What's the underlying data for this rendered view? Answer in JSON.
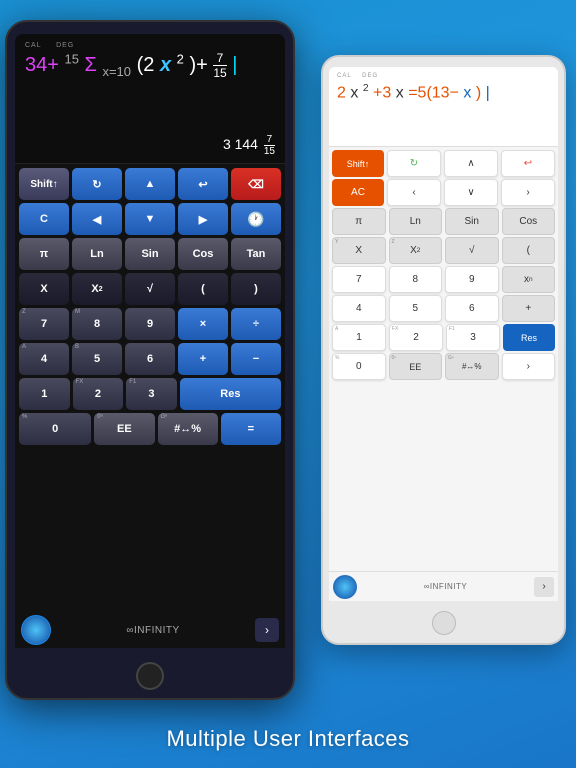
{
  "page": {
    "background": "#2196e0",
    "bottom_text": "Multiple User Interfaces"
  },
  "dark_tablet": {
    "mode": "CAL    DEG",
    "expression": "34+ Σ(2x²)+ 7/15",
    "result": "3 144 7/15",
    "rows": [
      [
        "Shift↑",
        "→",
        "▲",
        "↩",
        "⌫"
      ],
      [
        "C",
        "◀",
        "▼",
        "▶",
        "🕐"
      ],
      [
        "π",
        "Ln",
        "Sin",
        "Cos",
        "Tan"
      ],
      [
        "X",
        "X²",
        "√",
        "(",
        ")"
      ],
      [
        "7",
        "8",
        "9",
        "×",
        "÷"
      ],
      [
        "4",
        "5",
        "6",
        "+",
        "−"
      ],
      [
        "1",
        "2",
        "3",
        "Res",
        "="
      ],
      [
        "0",
        "EE",
        "#↔%",
        "=",
        ""
      ]
    ],
    "bottom": {
      "infinity_text": "∞INFINITY",
      "arrow": "›"
    }
  },
  "white_tablet": {
    "mode": "CAL    DEG",
    "expression": "2x²+3x=5(13−x)",
    "rows": [
      [
        "Shift↑",
        "↺",
        "∧",
        "↩"
      ],
      [
        "AC",
        "‹",
        "∨",
        "›"
      ],
      [
        "π",
        "Ln",
        "Sin",
        "Cos"
      ],
      [
        "X",
        "X²",
        "√",
        "("
      ],
      [
        "7",
        "8",
        "9",
        "xⁿ"
      ],
      [
        "4",
        "5",
        "6",
        "+"
      ],
      [
        "1",
        "2",
        "3",
        "Res"
      ],
      [
        "0",
        "EE",
        "#↔%",
        ">"
      ]
    ],
    "bottom": {
      "infinity_text": "∞INFINITY",
      "arrow": "›"
    }
  }
}
